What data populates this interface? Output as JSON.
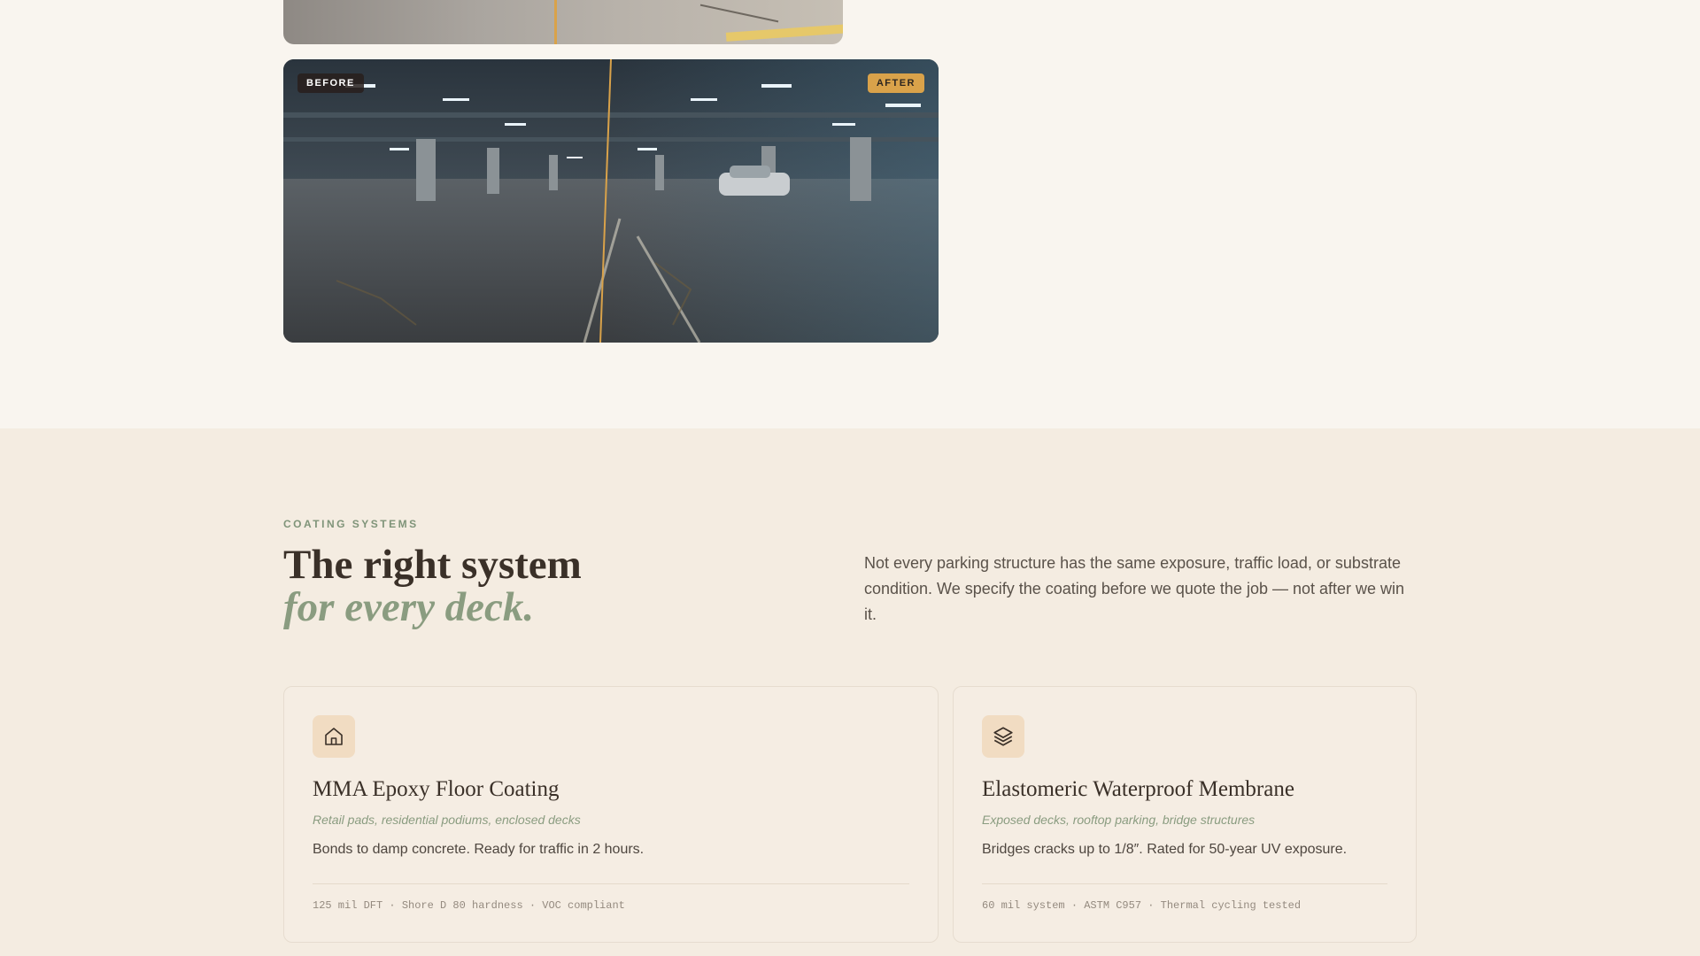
{
  "hero": {
    "before_label": "BEFORE",
    "after_label": "AFTER"
  },
  "systems": {
    "eyebrow": "COATING SYSTEMS",
    "headline_line1": "The right system",
    "headline_line2": "for every deck.",
    "lede": "Not every parking structure has the same exposure, traffic load, or substrate condition. We specify the coating before we quote the job — not after we win it.",
    "cards": [
      {
        "icon": "home-icon",
        "title": "MMA Epoxy Floor Coating",
        "subtitle": "Retail pads, residential podiums, enclosed decks",
        "description": "Bonds to damp concrete. Ready for traffic in 2 hours.",
        "specs": "125 mil DFT · Shore D 80 hardness · VOC compliant"
      },
      {
        "icon": "layers-icon",
        "title": "Elastomeric Waterproof Membrane",
        "subtitle": "Exposed decks, rooftop parking, bridge structures",
        "description": "Bridges cracks up to 1/8″. Rated for 50-year UV exposure.",
        "specs": "60 mil system · ASTM C957 · Thermal cycling tested"
      }
    ]
  },
  "colors": {
    "accent_gold": "#d9a24a",
    "sage": "#8a9c80",
    "page_bg": "#f9f5ef",
    "section_bg": "#f4ece1"
  }
}
